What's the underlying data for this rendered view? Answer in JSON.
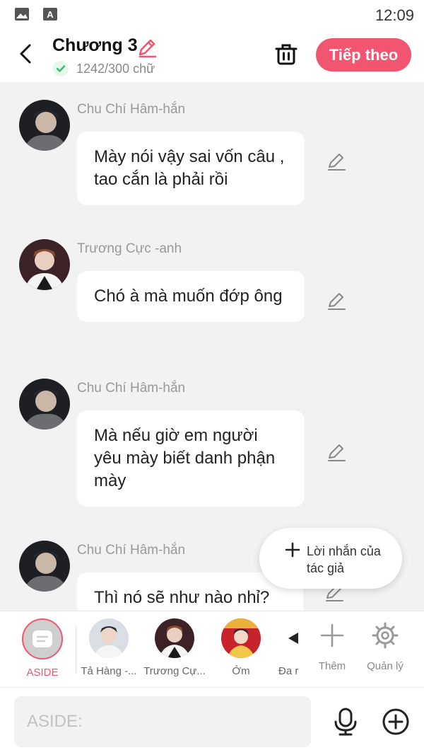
{
  "status_bar": {
    "time": "12:09",
    "icons": [
      "image-icon",
      "font-a-icon"
    ]
  },
  "header": {
    "title": "Chương 3",
    "word_count": "1242/300 chữ",
    "next_label": "Tiếp theo"
  },
  "colors": {
    "accent": "#f2556f",
    "check": "#2fbf71",
    "background": "#f2f2f2"
  },
  "messages": [
    {
      "name": "Chu Chí Hâm-hắn",
      "text": "Mày nói vậy sai vốn câu , tao cắn là phải rồi"
    },
    {
      "name": "Trương Cực -anh",
      "text": "Chó à mà muốn đớp ông"
    },
    {
      "name": "Chu Chí Hâm-hắn",
      "text": "Mà nếu giờ em người yêu mày biết danh phận mày"
    },
    {
      "name": "Chu Chí Hâm-hắn",
      "text": "Thì nó sẽ như nào nhỉ?"
    }
  ],
  "fab": {
    "label": "Lời nhắn của tác giả"
  },
  "characters": [
    {
      "label": "ASIDE"
    },
    {
      "label": "Tả Hàng -..."
    },
    {
      "label": "Trương Cự..."
    },
    {
      "label": "Ởm"
    },
    {
      "label": "Đa r"
    }
  ],
  "tools": {
    "add_label": "Thêm",
    "manage_label": "Quản lý"
  },
  "input": {
    "placeholder": "ASIDE:"
  }
}
